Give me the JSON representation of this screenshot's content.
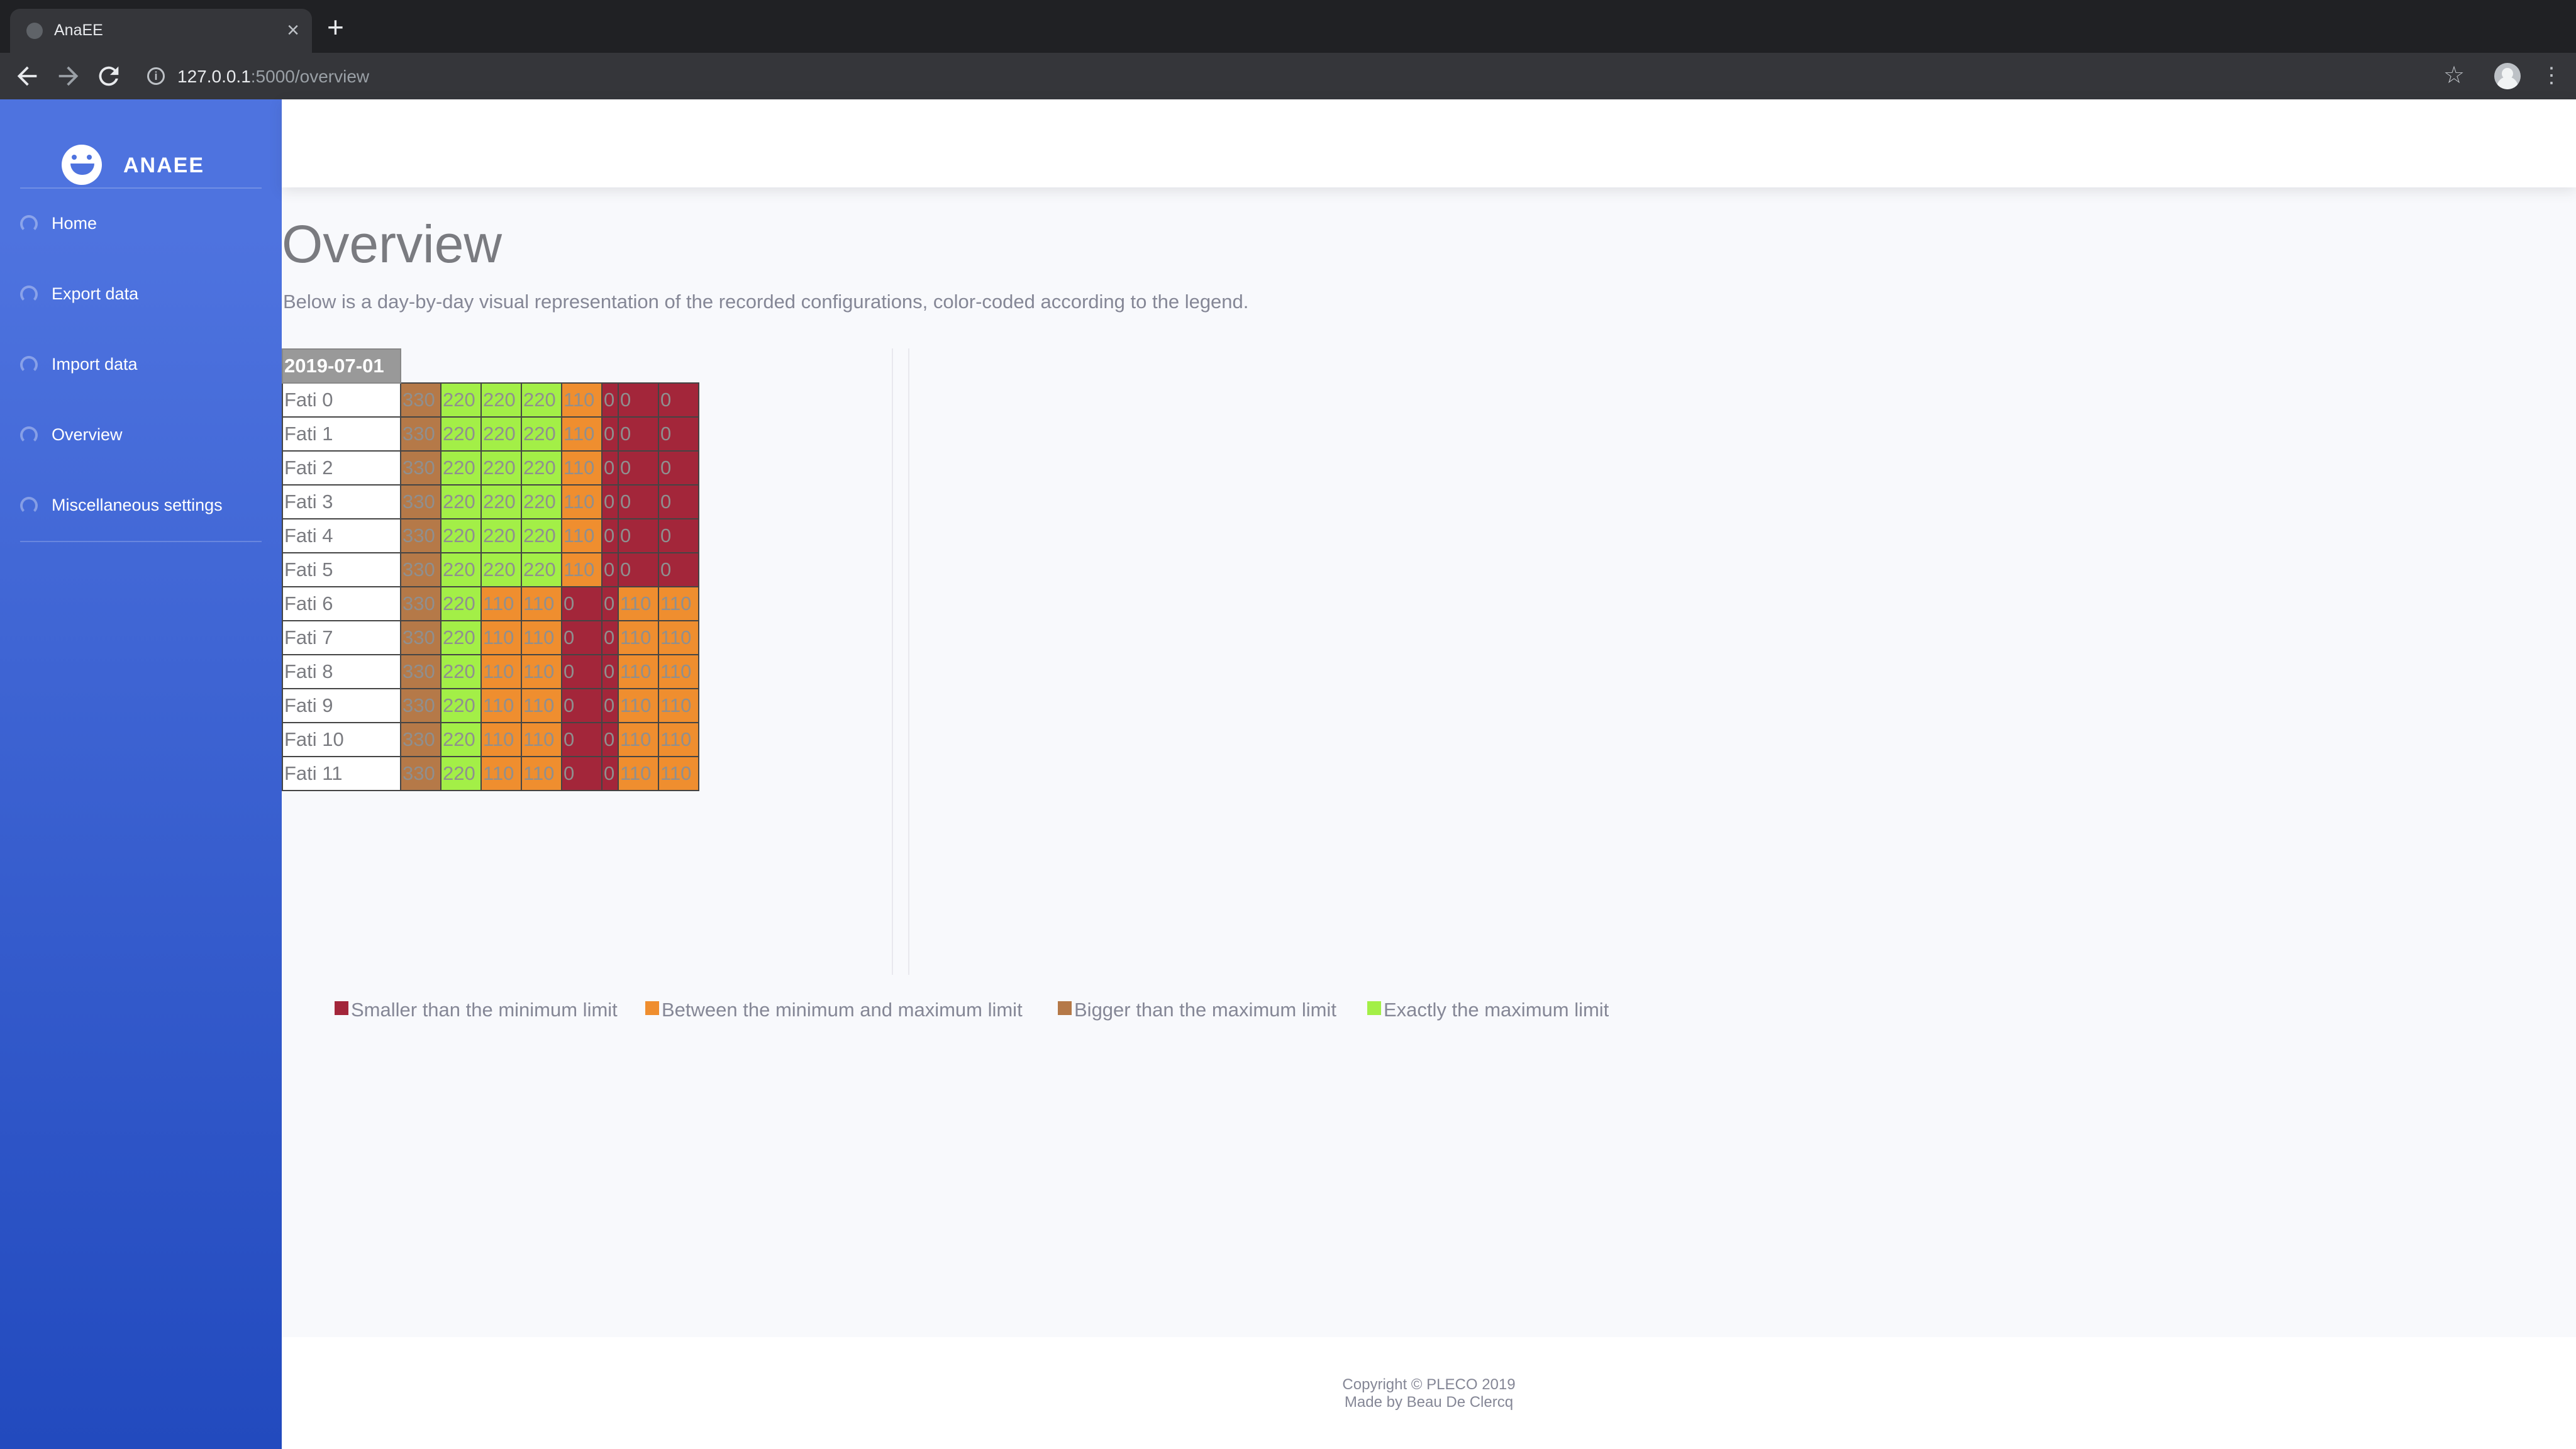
{
  "browser": {
    "tab_title": "AnaEE",
    "url_host": "127.0.0.1",
    "url_path": ":5000/overview"
  },
  "sidebar": {
    "brand": "ANAEE",
    "items": [
      {
        "label": "Home"
      },
      {
        "label": "Export data"
      },
      {
        "label": "Import data"
      },
      {
        "label": "Overview"
      },
      {
        "label": "Miscellaneous settings"
      }
    ]
  },
  "main": {
    "title": "Overview",
    "description": "Below is a day-by-day visual representation of the recorded configurations, color-coded according to the legend.",
    "date": "2019-07-01",
    "rows": [
      {
        "label": "Fati 0",
        "values": [
          "330",
          "220",
          "220",
          "220",
          "110",
          "0",
          "0",
          "0"
        ]
      },
      {
        "label": "Fati 1",
        "values": [
          "330",
          "220",
          "220",
          "220",
          "110",
          "0",
          "0",
          "0"
        ]
      },
      {
        "label": "Fati 2",
        "values": [
          "330",
          "220",
          "220",
          "220",
          "110",
          "0",
          "0",
          "0"
        ]
      },
      {
        "label": "Fati 3",
        "values": [
          "330",
          "220",
          "220",
          "220",
          "110",
          "0",
          "0",
          "0"
        ]
      },
      {
        "label": "Fati 4",
        "values": [
          "330",
          "220",
          "220",
          "220",
          "110",
          "0",
          "0",
          "0"
        ]
      },
      {
        "label": "Fati 5",
        "values": [
          "330",
          "220",
          "220",
          "220",
          "110",
          "0",
          "0",
          "0"
        ]
      },
      {
        "label": "Fati 6",
        "values": [
          "330",
          "220",
          "110",
          "110",
          "0",
          "0",
          "110",
          "110"
        ]
      },
      {
        "label": "Fati 7",
        "values": [
          "330",
          "220",
          "110",
          "110",
          "0",
          "0",
          "110",
          "110"
        ]
      },
      {
        "label": "Fati 8",
        "values": [
          "330",
          "220",
          "110",
          "110",
          "0",
          "0",
          "110",
          "110"
        ]
      },
      {
        "label": "Fati 9",
        "values": [
          "330",
          "220",
          "110",
          "110",
          "0",
          "0",
          "110",
          "110"
        ]
      },
      {
        "label": "Fati 10",
        "values": [
          "330",
          "220",
          "110",
          "110",
          "0",
          "0",
          "110",
          "110"
        ]
      },
      {
        "label": "Fati 11",
        "values": [
          "330",
          "220",
          "110",
          "110",
          "0",
          "0",
          "110",
          "110"
        ]
      }
    ],
    "status_colors": {
      "below_min": "#a3263a",
      "between": "#ef8e2f",
      "above_max": "#b57948",
      "exact_max": "#a3ef47"
    },
    "legend": [
      {
        "label": "Smaller than the minimum limit",
        "color": "#a3263a"
      },
      {
        "label": "Between the minimum and maximum limit",
        "color": "#ef8e2f"
      },
      {
        "label": "Bigger than the maximum limit",
        "color": "#b57948"
      },
      {
        "label": "Exactly the maximum limit",
        "color": "#a3ef47"
      }
    ]
  },
  "footer": {
    "copyright": "Copyright © PLECO 2019",
    "made_by": "Made by Beau De Clercq"
  }
}
